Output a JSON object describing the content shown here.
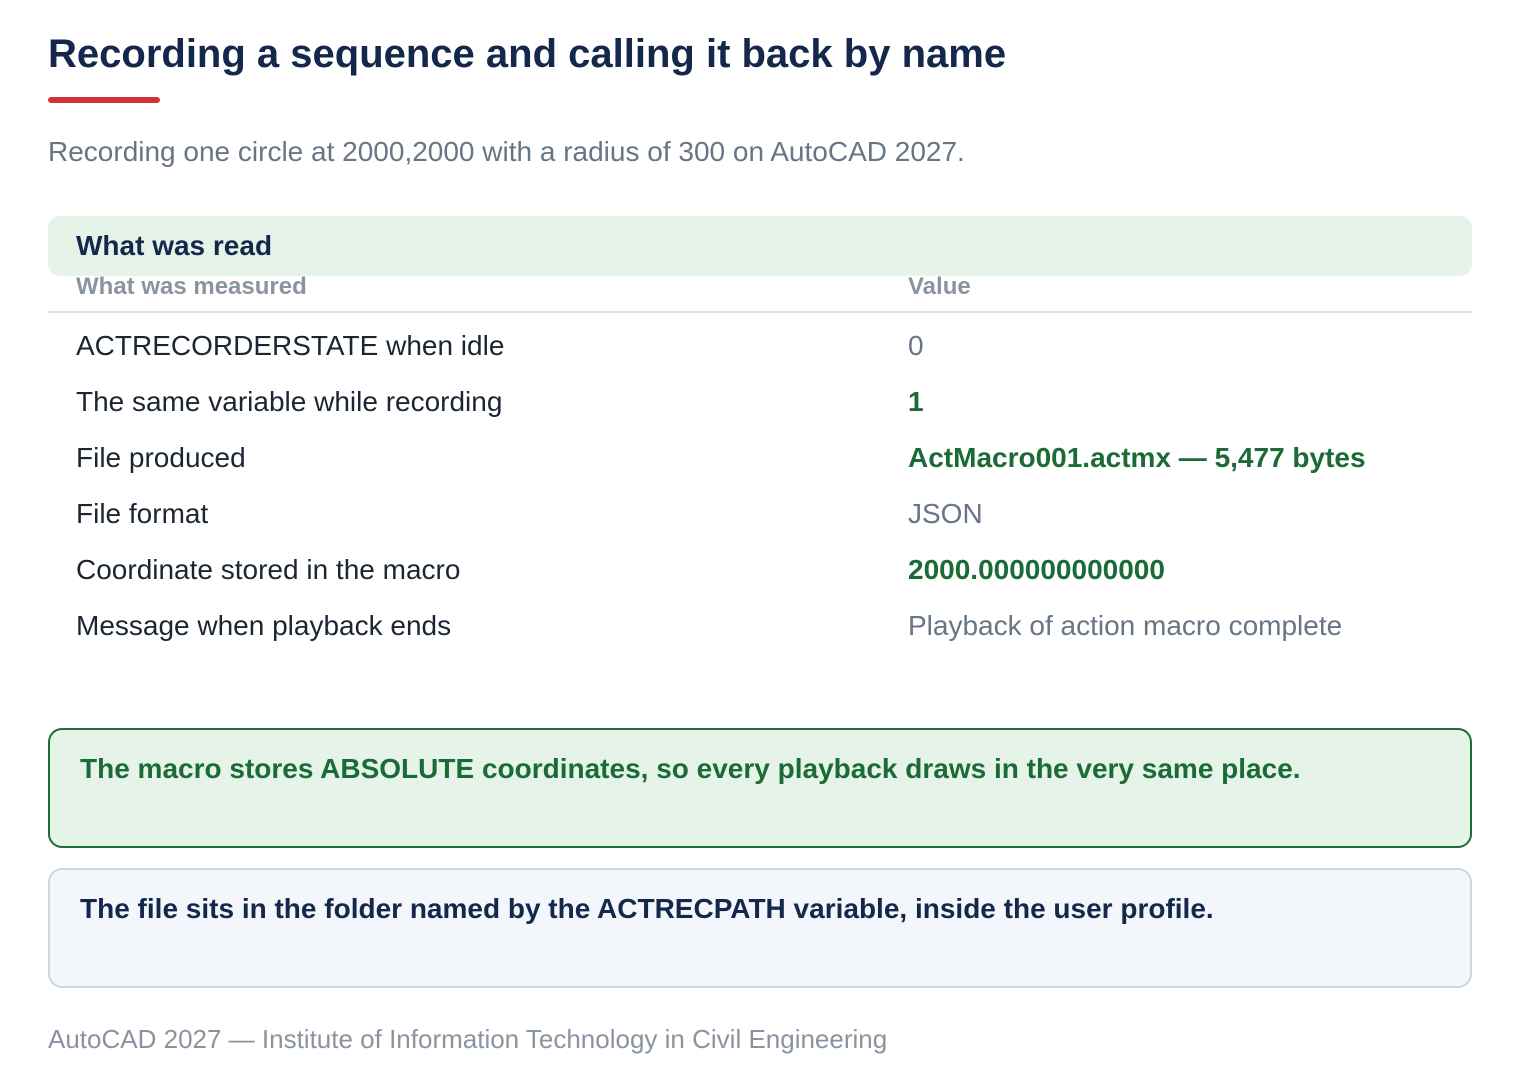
{
  "title": "Recording a sequence and calling it back by name",
  "subtitle": "Recording one circle at 2000,2000 with a radius of 300 on AutoCAD 2027.",
  "section": {
    "header": "What was read",
    "columns": [
      "What was measured",
      "Value"
    ],
    "rows": [
      {
        "label": "ACTRECORDERSTATE when idle",
        "value": "0",
        "highlight": false
      },
      {
        "label": "The same variable while recording",
        "value": "1",
        "highlight": true
      },
      {
        "label": "File produced",
        "value": "ActMacro001.actmx — 5,477 bytes",
        "highlight": true
      },
      {
        "label": "File format",
        "value": "JSON",
        "highlight": false
      },
      {
        "label": "Coordinate stored in the macro",
        "value": "2000.000000000000",
        "highlight": true
      },
      {
        "label": "Message when playback ends",
        "value": "Playback of action macro complete",
        "highlight": false
      }
    ]
  },
  "callouts": [
    {
      "text": "The macro stores ABSOLUTE coordinates, so every playback draws in the very same place.",
      "tone": "success"
    },
    {
      "text": "The file sits in the folder named by the ACTRECPATH variable, inside the user profile.",
      "tone": "info"
    }
  ],
  "footer": "AutoCAD 2027 — Institute of Information Technology in Civil Engineering",
  "colors": {
    "title": "#14284b",
    "accent_rule": "#d0313a",
    "highlight_value": "#1b6b36",
    "success_bg": "#e6f3e9",
    "success_border": "#1f6b3a",
    "info_bg": "#f3f6fb",
    "info_border": "#cdd7e3"
  }
}
